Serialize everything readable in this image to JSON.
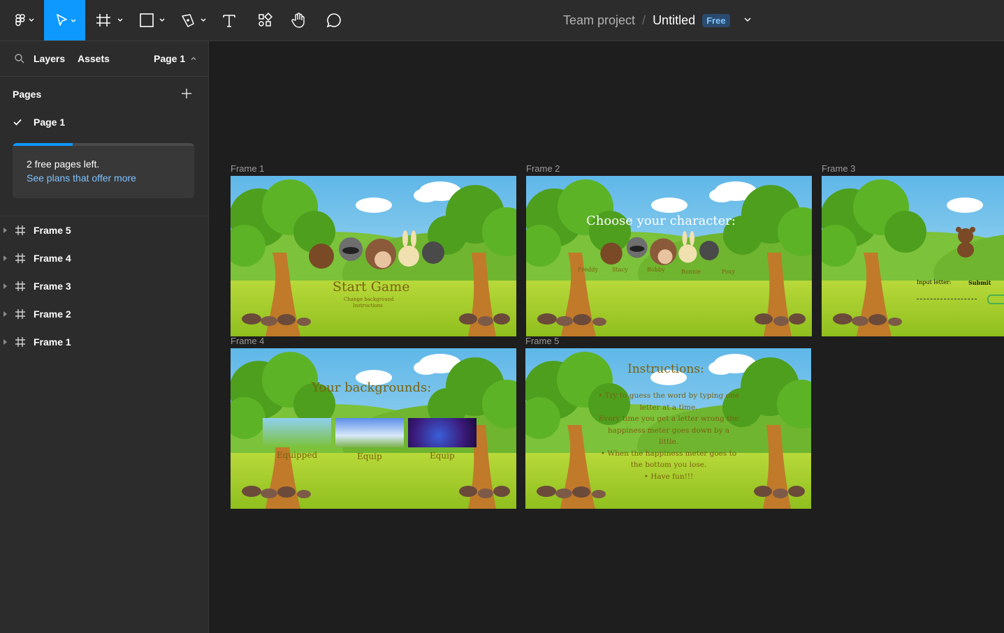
{
  "toolbar": {
    "project": "Team project",
    "separator": "/",
    "file_name": "Untitled",
    "plan_badge": "Free",
    "accent": "#0d99ff"
  },
  "sidebar": {
    "tabs": {
      "layers": "Layers",
      "assets": "Assets",
      "page_selector": "Page 1"
    },
    "pages_heading": "Pages",
    "current_page": "Page 1",
    "upsell": {
      "line1": "2 free pages left.",
      "link": "See plans that offer more",
      "progress": 0.33
    },
    "layers": [
      "Frame 5",
      "Frame 4",
      "Frame 3",
      "Frame 2",
      "Frame 1"
    ]
  },
  "canvas": {
    "frames": {
      "f1": {
        "label": "Frame 1",
        "title": "Start Game",
        "sub1": "Change background",
        "sub2": "Instructions"
      },
      "f2": {
        "label": "Frame 2",
        "title": "Choose your character:",
        "names": [
          "Freddy",
          "Stacy",
          "Bobby",
          "Bonnie",
          "Foxy"
        ]
      },
      "f3": {
        "label": "Frame 3",
        "input_label": "Input letter:",
        "submit": "Submit"
      },
      "f4": {
        "label": "Frame 4",
        "title": "Your backgrounds:",
        "options": [
          "Equipped",
          "Equip",
          "Equip"
        ]
      },
      "f5": {
        "label": "Frame 5",
        "title": "Instructions:",
        "lines": [
          "• Try to guess the word by typing one",
          "letter at a time.",
          "Every time you get a letter wrong the",
          "happiness meter goes down by a",
          "little.",
          "• When the happiness meter goes to",
          "the bottom you lose.",
          "• Have fun!!!"
        ]
      }
    }
  }
}
